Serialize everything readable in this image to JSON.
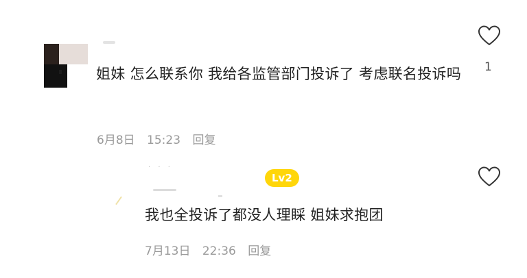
{
  "comments": [
    {
      "text": "姐妹 怎么联系你 我给各监管部门投诉了 考虑联名投诉吗",
      "date": "6月8日",
      "time": "15:23",
      "reply_label": "回复",
      "like_count": "1"
    },
    {
      "level_badge": "Lv2",
      "text": "我也全投诉了都没人理睬 姐妹求抱团",
      "date": "7月13日",
      "time": "22:36",
      "reply_label": "回复"
    }
  ],
  "icons": {
    "like": "heart-outline-icon"
  },
  "colors": {
    "badge": "#ffd60a",
    "meta_text": "#9a9a9a",
    "body_text": "#222222"
  }
}
